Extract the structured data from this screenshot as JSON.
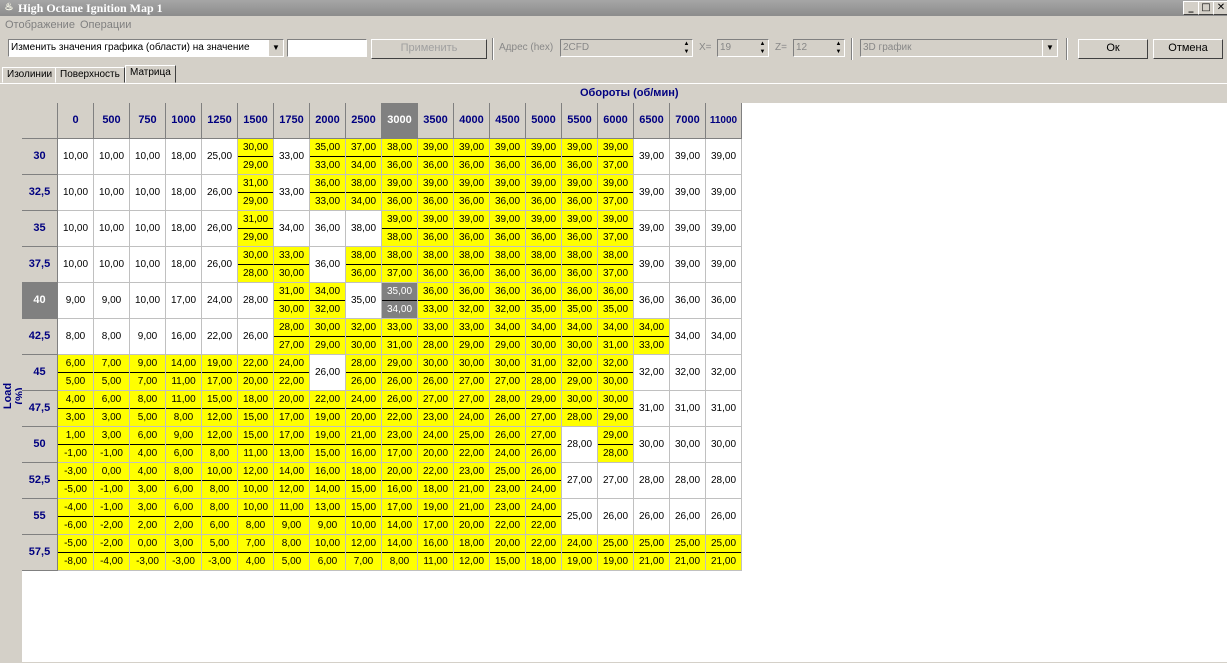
{
  "window": {
    "title": "High Octane Ignition Map 1",
    "icon": "flame-icon"
  },
  "menu": [
    "Отображение",
    "Операции"
  ],
  "toolbar": {
    "action_select": "Изменить значения графика (области) на значение",
    "value_input": "",
    "apply_label": "Применить",
    "addr_label": "Адрес (hex)",
    "addr_value": "2CFD",
    "x_label": "X=",
    "x_value": "19",
    "z_label": "Z=",
    "z_value": "12",
    "view_select": "3D график",
    "ok_label": "Ок",
    "cancel_label": "Отмена"
  },
  "tabs": [
    "Изолинии",
    "Поверхность",
    "Матрица"
  ],
  "active_tab": "Матрица",
  "x_axis_label": "Обороты (об/мин)",
  "y_axis_label": "Load (%)",
  "rpm": [
    "0",
    "500",
    "750",
    "1000",
    "1250",
    "1500",
    "1750",
    "2000",
    "2500",
    "3000",
    "3500",
    "4000",
    "4500",
    "5000",
    "5500",
    "6000",
    "6500",
    "7000",
    "11000"
  ],
  "load": [
    "30",
    "32,5",
    "35",
    "37,5",
    "40",
    "42,5",
    "45",
    "47,5",
    "50",
    "52,5",
    "55",
    "57,5"
  ],
  "selected_rpm": "3000",
  "selected_load": "40",
  "grid": [
    [
      "10,00",
      "10,00",
      "10,00",
      "18,00",
      "25,00",
      "30,00|29,00",
      "33,00",
      "35,00|33,00",
      "37,00|34,00",
      "38,00|36,00",
      "39,00|36,00",
      "39,00|36,00",
      "39,00|36,00",
      "39,00|36,00",
      "39,00|36,00",
      "39,00|37,00",
      "39,00",
      "39,00",
      "39,00"
    ],
    [
      "10,00",
      "10,00",
      "10,00",
      "18,00",
      "26,00",
      "31,00|29,00",
      "33,00",
      "36,00|33,00",
      "38,00|34,00",
      "39,00|36,00",
      "39,00|36,00",
      "39,00|36,00",
      "39,00|36,00",
      "39,00|36,00",
      "39,00|36,00",
      "39,00|37,00",
      "39,00",
      "39,00",
      "39,00"
    ],
    [
      "10,00",
      "10,00",
      "10,00",
      "18,00",
      "26,00",
      "31,00|29,00",
      "34,00",
      "36,00",
      "38,00",
      "39,00|38,00",
      "39,00|36,00",
      "39,00|36,00",
      "39,00|36,00",
      "39,00|36,00",
      "39,00|36,00",
      "39,00|37,00",
      "39,00",
      "39,00",
      "39,00"
    ],
    [
      "10,00",
      "10,00",
      "10,00",
      "18,00",
      "26,00",
      "30,00|28,00",
      "33,00|30,00",
      "36,00",
      "38,00|36,00",
      "38,00|37,00",
      "38,00|36,00",
      "38,00|36,00",
      "38,00|36,00",
      "38,00|36,00",
      "38,00|36,00",
      "38,00|37,00",
      "39,00",
      "39,00",
      "39,00"
    ],
    [
      "9,00",
      "9,00",
      "10,00",
      "17,00",
      "24,00",
      "28,00",
      "31,00|30,00",
      "34,00|32,00",
      "35,00",
      "35,00|34,00",
      "36,00|33,00",
      "36,00|32,00",
      "36,00|32,00",
      "36,00|35,00",
      "36,00|35,00",
      "36,00|35,00",
      "36,00",
      "36,00",
      "36,00"
    ],
    [
      "8,00",
      "8,00",
      "9,00",
      "16,00",
      "22,00",
      "26,00",
      "28,00|27,00",
      "30,00|29,00",
      "32,00|30,00",
      "33,00|31,00",
      "33,00|28,00",
      "33,00|29,00",
      "34,00|29,00",
      "34,00|30,00",
      "34,00|30,00",
      "34,00|31,00",
      "34,00|33,00",
      "34,00",
      "34,00"
    ],
    [
      "6,00|5,00",
      "7,00|5,00",
      "9,00|7,00",
      "14,00|11,00",
      "19,00|17,00",
      "22,00|20,00",
      "24,00|22,00",
      "26,00",
      "28,00|26,00",
      "29,00|26,00",
      "30,00|26,00",
      "30,00|27,00",
      "30,00|27,00",
      "31,00|28,00",
      "32,00|29,00",
      "32,00|30,00",
      "32,00",
      "32,00",
      "32,00"
    ],
    [
      "4,00|3,00",
      "6,00|3,00",
      "8,00|5,00",
      "11,00|8,00",
      "15,00|12,00",
      "18,00|15,00",
      "20,00|17,00",
      "22,00|19,00",
      "24,00|20,00",
      "26,00|22,00",
      "27,00|23,00",
      "27,00|24,00",
      "28,00|26,00",
      "29,00|27,00",
      "30,00|28,00",
      "30,00|29,00",
      "31,00",
      "31,00",
      "31,00"
    ],
    [
      "1,00|-1,00",
      "3,00|-1,00",
      "6,00|4,00",
      "9,00|6,00",
      "12,00|8,00",
      "15,00|11,00",
      "17,00|13,00",
      "19,00|15,00",
      "21,00|16,00",
      "23,00|17,00",
      "24,00|20,00",
      "25,00|22,00",
      "26,00|24,00",
      "27,00|26,00",
      "28,00",
      "29,00|28,00",
      "30,00",
      "30,00",
      "30,00"
    ],
    [
      "-3,00|-5,00",
      "0,00|-1,00",
      "4,00|3,00",
      "8,00|6,00",
      "10,00|8,00",
      "12,00|10,00",
      "14,00|12,00",
      "16,00|14,00",
      "18,00|15,00",
      "20,00|16,00",
      "22,00|18,00",
      "23,00|21,00",
      "25,00|23,00",
      "26,00|24,00",
      "27,00",
      "27,00",
      "28,00",
      "28,00",
      "28,00"
    ],
    [
      "-4,00|-6,00",
      "-1,00|-2,00",
      "3,00|2,00",
      "6,00|2,00",
      "8,00|6,00",
      "10,00|8,00",
      "11,00|9,00",
      "13,00|9,00",
      "15,00|10,00",
      "17,00|14,00",
      "19,00|17,00",
      "21,00|20,00",
      "23,00|22,00",
      "24,00|22,00",
      "25,00",
      "26,00",
      "26,00",
      "26,00",
      "26,00"
    ],
    [
      "-5,00|-8,00",
      "-2,00|-4,00",
      "0,00|-3,00",
      "3,00|-3,00",
      "5,00|-3,00",
      "7,00|4,00",
      "8,00|5,00",
      "10,00|6,00",
      "12,00|7,00",
      "14,00|8,00",
      "16,00|11,00",
      "18,00|12,00",
      "20,00|15,00",
      "22,00|18,00",
      "24,00|19,00",
      "25,00|19,00",
      "25,00|21,00",
      "25,00|21,00",
      "25,00|21,00"
    ]
  ],
  "highlight_color": "#ffff00",
  "selected_cell_color": "#808080"
}
